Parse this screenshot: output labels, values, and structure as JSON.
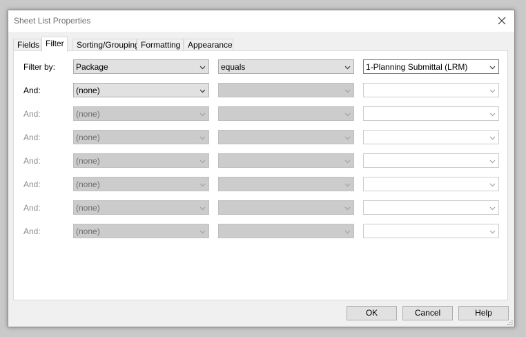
{
  "window": {
    "title": "Sheet List Properties"
  },
  "tabs": [
    {
      "label": "Fields"
    },
    {
      "label": "Filter"
    },
    {
      "label": "Sorting/Grouping"
    },
    {
      "label": "Formatting"
    },
    {
      "label": "Appearance"
    }
  ],
  "active_tab": "Filter",
  "filters": [
    {
      "label": "Filter by:",
      "field": "Package",
      "operator": "equals",
      "value": "1-Planning Submittal (LRM)"
    },
    {
      "label": "And:",
      "field": "(none)",
      "operator": "",
      "value": ""
    },
    {
      "label": "And:",
      "field": "(none)",
      "operator": "",
      "value": ""
    },
    {
      "label": "And:",
      "field": "(none)",
      "operator": "",
      "value": ""
    },
    {
      "label": "And:",
      "field": "(none)",
      "operator": "",
      "value": ""
    },
    {
      "label": "And:",
      "field": "(none)",
      "operator": "",
      "value": ""
    },
    {
      "label": "And:",
      "field": "(none)",
      "operator": "",
      "value": ""
    },
    {
      "label": "And:",
      "field": "(none)",
      "operator": "",
      "value": ""
    }
  ],
  "buttons": {
    "ok": "OK",
    "cancel": "Cancel",
    "help": "Help"
  },
  "colors": {
    "disabled_combo": "#cccccc",
    "disabled_text": "#8d8d8d",
    "window_bg": "#f0f0f0"
  },
  "icons": {
    "close": "close-icon",
    "dropdown": "chevron-down-icon",
    "resize": "resize-grip-icon"
  }
}
